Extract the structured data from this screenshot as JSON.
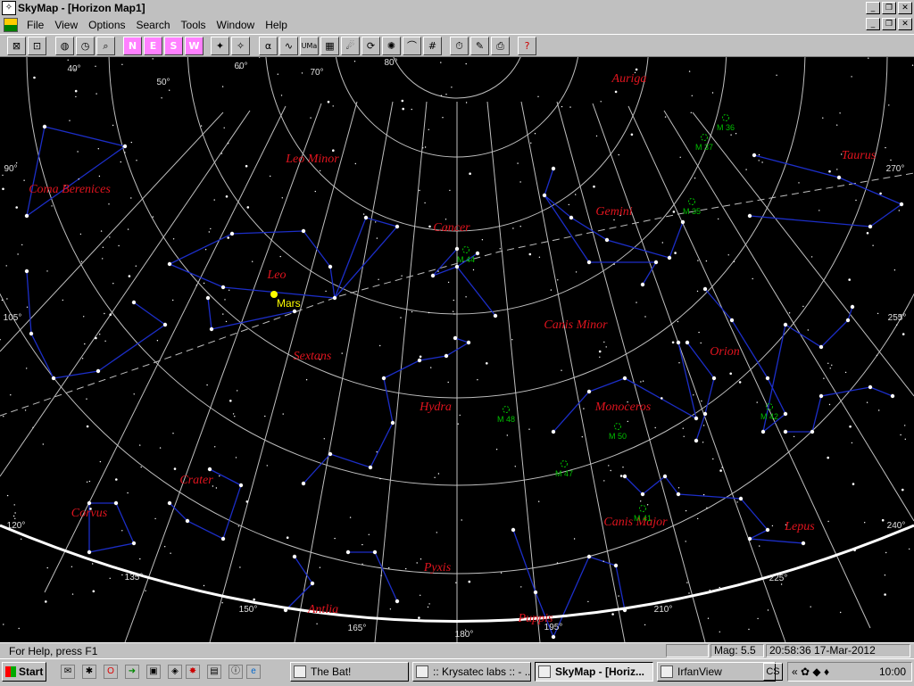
{
  "window": {
    "title": "SkyMap - [Horizon Map1]"
  },
  "menu": [
    {
      "label": "File",
      "accel": "F"
    },
    {
      "label": "View",
      "accel": "V"
    },
    {
      "label": "Options",
      "accel": "O"
    },
    {
      "label": "Search",
      "accel": "S"
    },
    {
      "label": "Tools",
      "accel": "T"
    },
    {
      "label": "Window",
      "accel": "W"
    },
    {
      "label": "Help",
      "accel": "H"
    }
  ],
  "toolbar": {
    "directions": [
      "N",
      "E",
      "S",
      "W"
    ],
    "buttons": [
      "zoom-box-icon",
      "zoom-fit-icon",
      "globe-icon",
      "clock-icon",
      "find-icon",
      "star-icon",
      "star-label-icon",
      "alpha-icon",
      "milky-way-icon",
      "uma-icon",
      "grid-icon",
      "comet-icon",
      "galaxy-icon",
      "nebula-icon",
      "horizon-icon",
      "coordinate-grid-icon",
      "time-icon",
      "pencil-icon",
      "print-icon",
      "help-icon"
    ]
  },
  "map": {
    "constellations": [
      "Auriga",
      "Taurus",
      "Leo Minor",
      "Coma Berenices",
      "Gemini",
      "Cancer",
      "Leo",
      "Canis Minor",
      "Orion",
      "Sextans",
      "Hydra",
      "Monoceros",
      "Crater",
      "Corvus",
      "Canis Major",
      "Lepus",
      "Pyxis",
      "Antlia",
      "Puppis"
    ],
    "planets": [
      {
        "name": "Mars",
        "color": "#ffff00"
      }
    ],
    "deep_sky": [
      "M 36",
      "M 37",
      "M 35",
      "M 44",
      "M 48",
      "M 50",
      "M 47",
      "M 42",
      "M 41"
    ],
    "altitude_labels": [
      "40°",
      "50°",
      "60°",
      "70°",
      "80°"
    ],
    "azimuth_labels": [
      "90°",
      "105°",
      "120°",
      "135°",
      "150°",
      "165°",
      "180°",
      "195°",
      "210°",
      "225°",
      "240°",
      "255°",
      "270°"
    ],
    "colors": {
      "background": "#000000",
      "grid": "#bfbfbf",
      "constellation_lines": "#1c2ec8",
      "constellation_names": "#e0141e",
      "deep_sky": "#00c000",
      "horizon": "#ffffff",
      "ecliptic": "#bfbfbf"
    }
  },
  "status": {
    "help": "For Help, press F1",
    "mag": "Mag: 5.5",
    "datetime": "20:58:36 17-Mar-2012"
  },
  "taskbar": {
    "start": "Start",
    "tasks": [
      "The Bat!",
      ":: Krysatec labs :: - ...",
      "SkyMap - [Horiz...",
      "IrfanView"
    ],
    "tray_button": "CS",
    "clock": "10:00"
  }
}
